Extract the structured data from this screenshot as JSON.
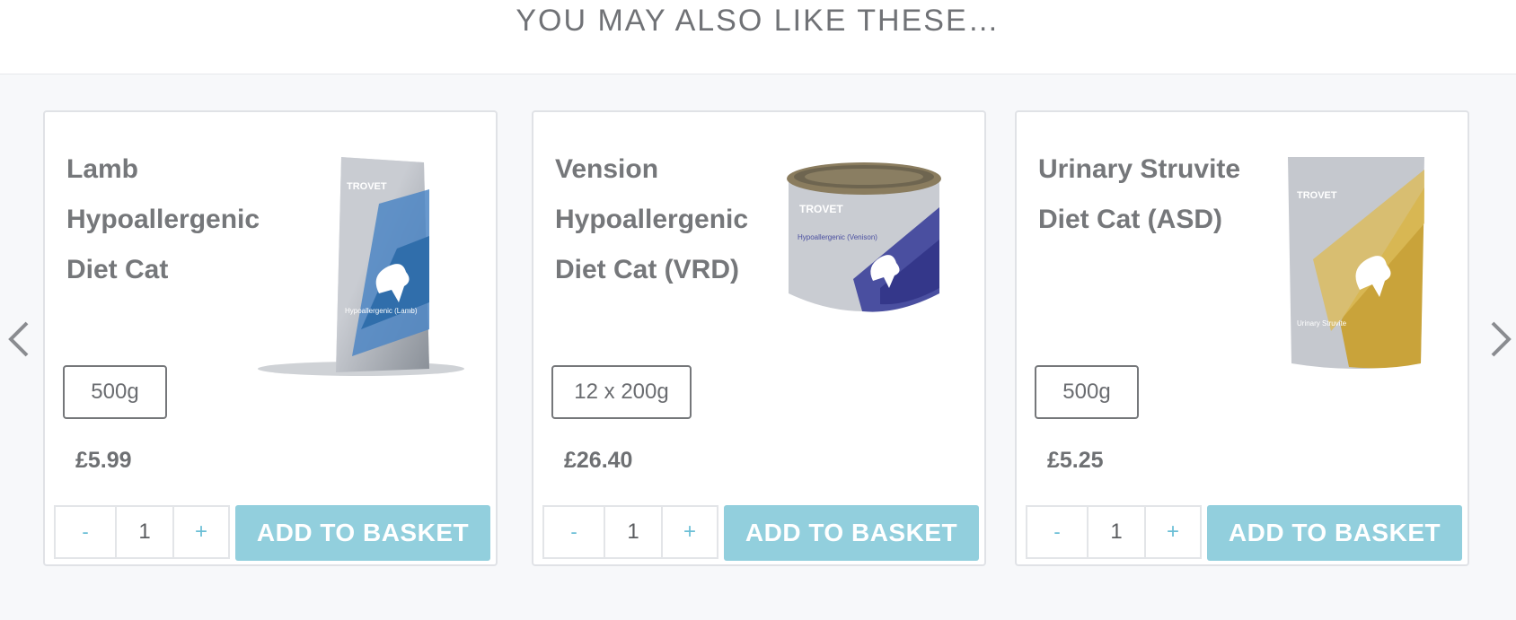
{
  "section": {
    "title": "YOU MAY ALSO LIKE THESE…"
  },
  "carousel": {
    "prev_icon": "chevron-left-icon",
    "next_icon": "chevron-right-icon",
    "products": [
      {
        "title": "Lamb Hypoallergenic Diet Cat",
        "variant": "500g",
        "price": "£5.99",
        "qty_minus": "-",
        "qty": "1",
        "qty_plus": "+",
        "button": "ADD TO BASKET",
        "image_brand": "TROVET",
        "image_label": "Hypoallergenic (Lamb)"
      },
      {
        "title": "Vension Hypoallergenic Diet Cat (VRD)",
        "variant": "12 x 200g",
        "price": "£26.40",
        "qty_minus": "-",
        "qty": "1",
        "qty_plus": "+",
        "button": "ADD TO BASKET",
        "image_brand": "TROVET",
        "image_label": "Hypoallergenic (Venison)"
      },
      {
        "title": "Urinary Struvite Diet Cat (ASD)",
        "variant": "500g",
        "price": "£5.25",
        "qty_minus": "-",
        "qty": "1",
        "qty_plus": "+",
        "button": "ADD TO BASKET",
        "image_brand": "TROVET",
        "image_label": "Urinary Struvite"
      }
    ]
  },
  "colors": {
    "accent": "#92cfdd",
    "text": "#75777a",
    "background": "#f7f8fa"
  }
}
